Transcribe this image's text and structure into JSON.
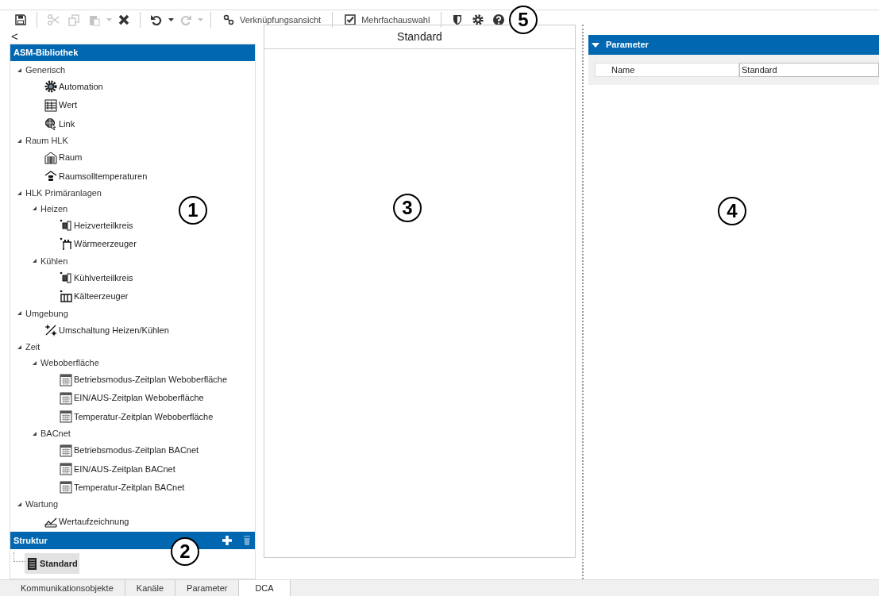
{
  "toolbar": {
    "items": [
      {
        "kind": "save",
        "disabled": false
      },
      {
        "kind": "sep"
      },
      {
        "kind": "cut",
        "disabled": true
      },
      {
        "kind": "copy",
        "disabled": true
      },
      {
        "kind": "paste",
        "disabled": true,
        "dropdown": true
      },
      {
        "kind": "delete",
        "disabled": false
      },
      {
        "kind": "sep"
      },
      {
        "kind": "undo",
        "disabled": false,
        "dropdown": true
      },
      {
        "kind": "redo",
        "disabled": true,
        "dropdown": true
      },
      {
        "kind": "sep"
      },
      {
        "kind": "linkview",
        "label": "Verknüpfungsansicht",
        "disabled": false
      },
      {
        "kind": "sep"
      },
      {
        "kind": "multiselect",
        "label": "Mehrfachauswahl",
        "disabled": false
      },
      {
        "kind": "sep"
      },
      {
        "kind": "shield",
        "disabled": false
      },
      {
        "kind": "gear",
        "disabled": false
      },
      {
        "kind": "help",
        "disabled": false
      }
    ]
  },
  "collapse_button": "<",
  "library": {
    "title": "ASM-Bibliothek",
    "tree": [
      {
        "label": "Generisch",
        "expanded": true,
        "children": [
          {
            "label": "Automation",
            "kind": "automation"
          },
          {
            "label": "Wert",
            "kind": "value"
          },
          {
            "label": "Link",
            "kind": "link"
          }
        ]
      },
      {
        "label": "Raum HLK",
        "expanded": true,
        "children": [
          {
            "label": "Raum",
            "kind": "room"
          },
          {
            "label": "Raumsolltemperaturen",
            "kind": "setpoint"
          }
        ]
      },
      {
        "label": "HLK Primäranlagen",
        "expanded": true,
        "children": [
          {
            "label": "Heizen",
            "expanded": true,
            "children": [
              {
                "label": "Heizverteilkreis",
                "kind": "circuit"
              },
              {
                "label": "Wärmeerzeuger",
                "kind": "generator"
              }
            ]
          },
          {
            "label": "Kühlen",
            "expanded": true,
            "children": [
              {
                "label": "Kühlverteilkreis",
                "kind": "circuit"
              },
              {
                "label": "Kälteerzeuger",
                "kind": "chiller"
              }
            ]
          }
        ]
      },
      {
        "label": "Umgebung",
        "expanded": true,
        "children": [
          {
            "label": "Umschaltung Heizen/Kühlen",
            "kind": "switch"
          }
        ]
      },
      {
        "label": "Zeit",
        "expanded": true,
        "children": [
          {
            "label": "Weboberfläche",
            "expanded": true,
            "children": [
              {
                "label": "Betriebsmodus-Zeitplan Weboberfläche",
                "kind": "schedule"
              },
              {
                "label": "EIN/AUS-Zeitplan Weboberfläche",
                "kind": "schedule"
              },
              {
                "label": "Temperatur-Zeitplan Weboberfläche",
                "kind": "schedule"
              }
            ]
          },
          {
            "label": "BACnet",
            "expanded": true,
            "children": [
              {
                "label": "Betriebsmodus-Zeitplan BACnet",
                "kind": "schedule"
              },
              {
                "label": "EIN/AUS-Zeitplan BACnet",
                "kind": "schedule"
              },
              {
                "label": "Temperatur-Zeitplan BACnet",
                "kind": "schedule"
              }
            ]
          }
        ]
      },
      {
        "label": "Wartung",
        "expanded": true,
        "children": [
          {
            "label": "Wertaufzeichnung",
            "kind": "log"
          }
        ]
      }
    ]
  },
  "structure": {
    "title": "Struktur",
    "items": [
      {
        "label": "Standard",
        "selected": true
      }
    ]
  },
  "canvas": {
    "title": "Standard"
  },
  "properties": {
    "section": "Parameter",
    "expanded": true,
    "rows": [
      {
        "name": "Name",
        "value": "Standard"
      }
    ]
  },
  "bottom_tabs": [
    {
      "label": "Kommunikationsobjekte",
      "selected": false
    },
    {
      "label": "Kanäle",
      "selected": false
    },
    {
      "label": "Parameter",
      "selected": false
    },
    {
      "label": "DCA",
      "selected": true
    }
  ],
  "callouts": [
    "1",
    "2",
    "3",
    "4",
    "5"
  ]
}
